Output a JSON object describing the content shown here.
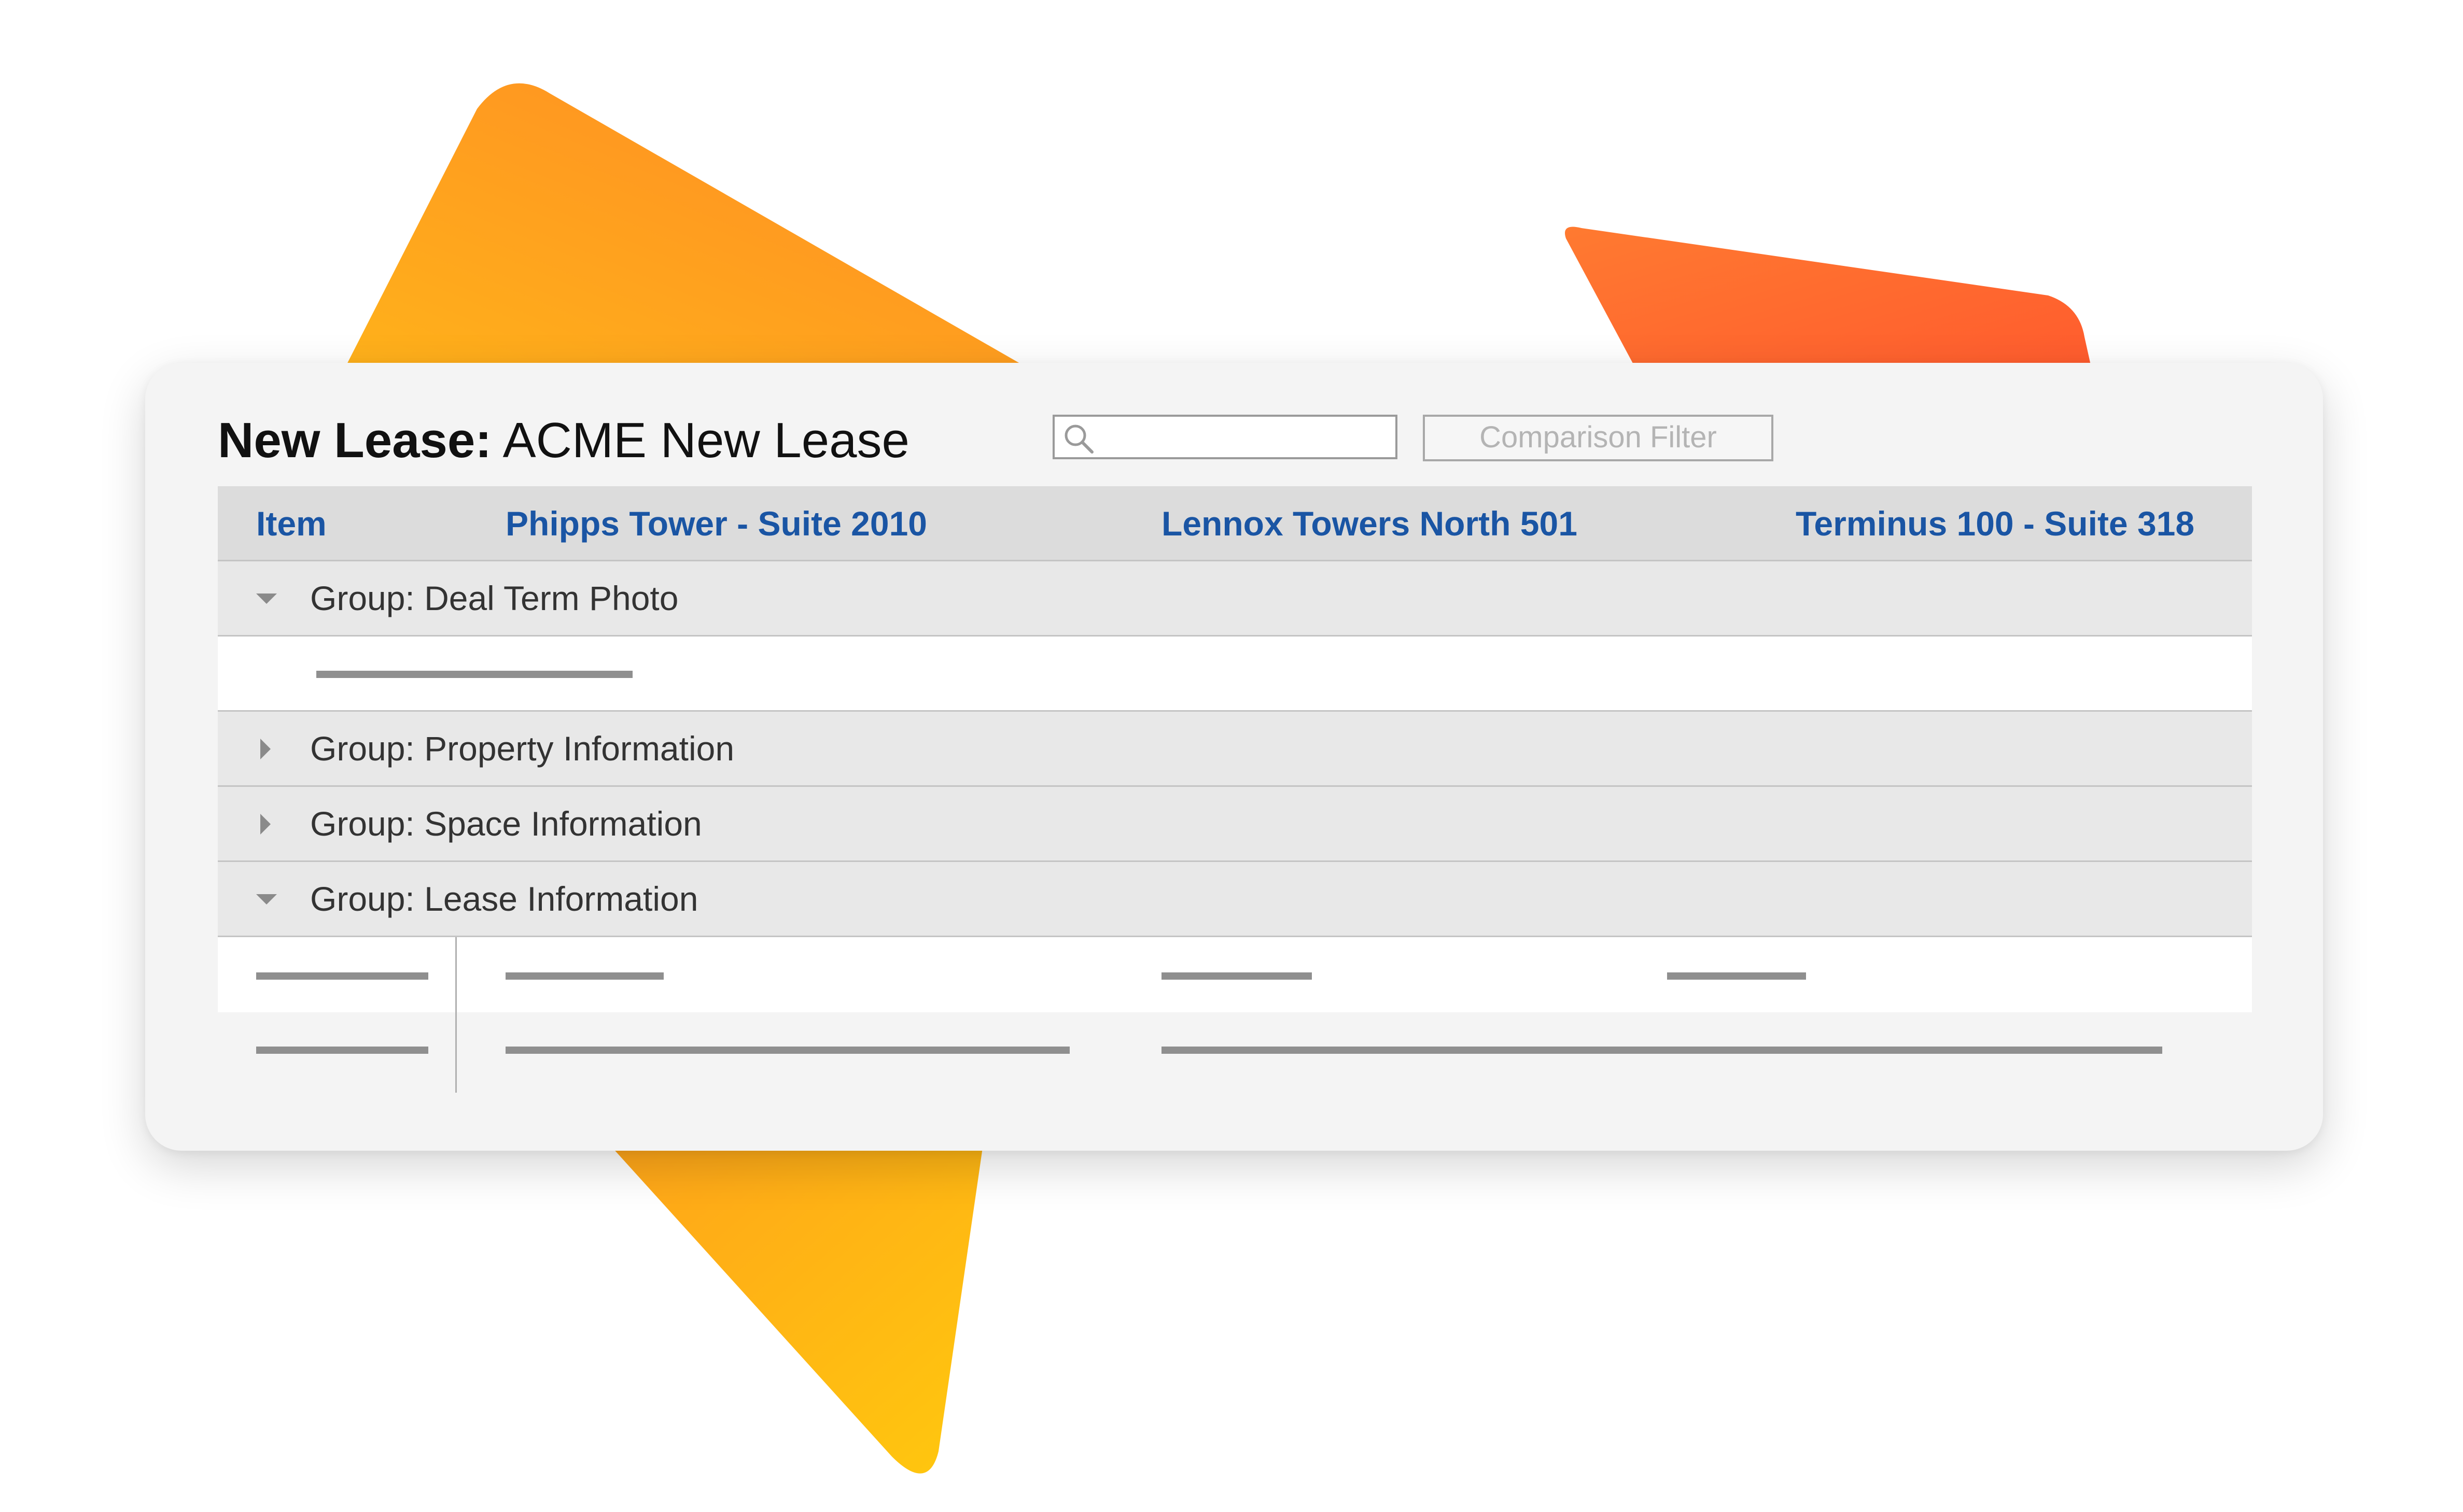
{
  "title": {
    "label": "New Lease:",
    "name": "ACME New Lease"
  },
  "search": {
    "value": "",
    "placeholder": ""
  },
  "filter": {
    "label": "Comparison Filter"
  },
  "columns": {
    "item": "Item",
    "col1": "Phipps Tower - Suite 2010",
    "col2": "Lennox Towers North 501",
    "col3": "Terminus 100 - Suite 318"
  },
  "groups": [
    {
      "label": "Group: Deal Term Photo",
      "expanded": true
    },
    {
      "label": "Group: Property Information",
      "expanded": false
    },
    {
      "label": "Group: Space Information",
      "expanded": false
    },
    {
      "label": "Group: Lease Information",
      "expanded": true
    }
  ],
  "colors": {
    "header_text": "#1a55a4",
    "shape_orange": "#ff8a1f",
    "shape_red_orange": "#ff5f2e",
    "shape_yellow": "#ffc20e"
  },
  "icons": [
    "search-icon",
    "caret-down-icon",
    "caret-right-icon"
  ]
}
